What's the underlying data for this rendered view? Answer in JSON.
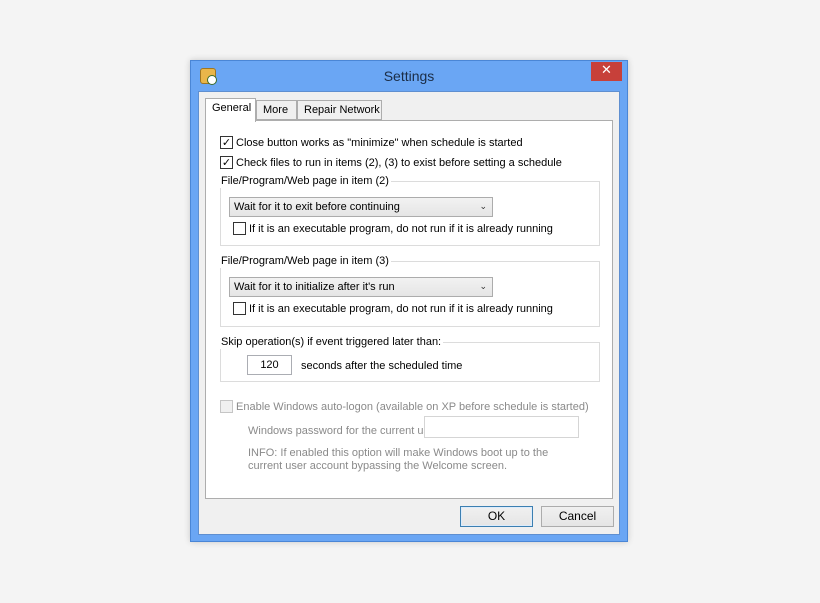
{
  "window": {
    "title": "Settings",
    "close_glyph": "✕",
    "icon": "clock-app-icon"
  },
  "tabs": [
    {
      "label": "General",
      "active": true
    },
    {
      "label": "More",
      "active": false
    },
    {
      "label": "Repair Network",
      "active": false
    }
  ],
  "general": {
    "close_minimize": {
      "label": "Close button works as \"minimize\" when schedule is started",
      "checked": true
    },
    "check_files": {
      "label": "Check files to run in items (2), (3) to exist before setting a schedule",
      "checked": true
    },
    "item2": {
      "legend": "File/Program/Web page in item (2)",
      "selected": "Wait for it to exit before continuing",
      "skip_running": {
        "label": "If it is an executable program, do not run if it is already running",
        "checked": false
      }
    },
    "item3": {
      "legend": "File/Program/Web page in item (3)",
      "selected": "Wait for it to initialize after it's run",
      "skip_running": {
        "label": "If it is an executable program, do not run if it is already running",
        "checked": false
      }
    },
    "skip": {
      "legend": "Skip operation(s) if event triggered later than:",
      "value": "120",
      "suffix": "seconds after the scheduled time"
    },
    "autologon": {
      "label": "Enable Windows auto-logon (available on XP before schedule is started)",
      "checked": false,
      "enabled": false,
      "password_label": "Windows password for the current user:",
      "password_value": "",
      "info_line1": "INFO: If enabled this option will make Windows boot up to the",
      "info_line2": "current user account bypassing the Welcome screen."
    }
  },
  "buttons": {
    "ok": "OK",
    "cancel": "Cancel"
  },
  "glyphs": {
    "check": "✓",
    "chevron": "⌄"
  },
  "colors": {
    "frame": "#6aa6f4",
    "close": "#c7403a"
  }
}
